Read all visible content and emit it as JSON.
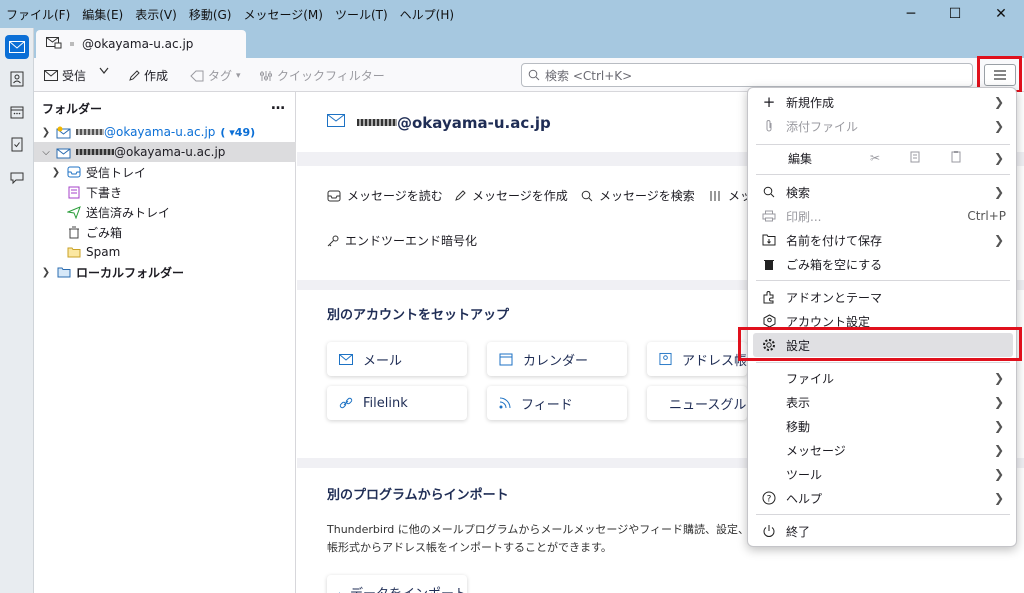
{
  "menubar": [
    "ファイル(F)",
    "編集(E)",
    "表示(V)",
    "移動(G)",
    "メッセージ(M)",
    "ツール(T)",
    "ヘルプ(H)"
  ],
  "window_controls": {
    "minimize": "─",
    "maximize": "☐",
    "close": "✕"
  },
  "tab": {
    "label": "@okayama-u.ac.jp"
  },
  "toolbar": {
    "get_mail": "受信",
    "write": "作成",
    "tag": "タグ",
    "quick_filter": "クイックフィルター"
  },
  "search": {
    "placeholder": "検索 <Ctrl+K>"
  },
  "folders": {
    "header": "フォルダー",
    "more": "…",
    "account1": "@okayama-u.ac.jp",
    "account1_unread": "( ▾49)",
    "account2": "@okayama-u.ac.jp",
    "items": [
      "受信トレイ",
      "下書き",
      "送信済みトレイ",
      "ごみ箱",
      "Spam",
      "ローカルフォルダー"
    ]
  },
  "account_header": {
    "email": "@okayama-u.ac.jp"
  },
  "actions": [
    "メッセージを読む",
    "メッセージを作成",
    "メッセージを検索",
    "メッ",
    "エンドツーエンド暗号化"
  ],
  "setup": {
    "title": "別のアカウントをセットアップ",
    "buttons": [
      "メール",
      "カレンダー",
      "アドレス帳",
      "Filelink",
      "フィード",
      "ニュースグル-"
    ]
  },
  "import": {
    "title": "別のプログラムからインポート",
    "desc_line1": "Thunderbird に他のメールプログラムからメールメッセージやフィード購読、設定、メッセージフィ",
    "desc_line2": "帳形式からアドレス帳をインポートすることができます。",
    "button": "データをインポート"
  },
  "appmenu": {
    "new": "新規作成",
    "attach": "添付ファイル",
    "edit": "編集",
    "find": "検索",
    "print": "印刷...",
    "print_shortcut": "Ctrl+P",
    "save_as": "名前を付けて保存",
    "empty_trash": "ごみ箱を空にする",
    "addons": "アドオンとテーマ",
    "account_settings": "アカウント設定",
    "settings": "設定",
    "file": "ファイル",
    "view": "表示",
    "go": "移動",
    "message": "メッセージ",
    "tools": "ツール",
    "help": "ヘルプ",
    "quit": "終了"
  },
  "colors": {
    "accent": "#0b6fd6",
    "highlight_red": "#e0101c",
    "titlebar": "#a6c8e0"
  }
}
